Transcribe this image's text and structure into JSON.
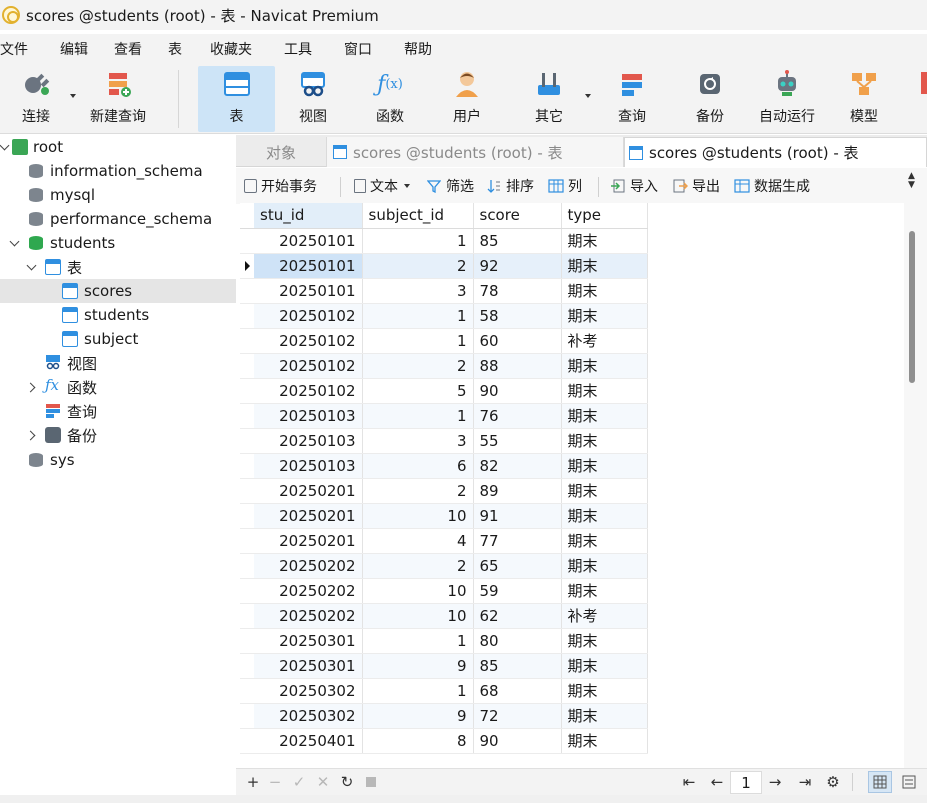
{
  "window": {
    "title": "scores @students (root) - 表 - Navicat Premium"
  },
  "menu": [
    "文件",
    "编辑",
    "查看",
    "表",
    "收藏夹",
    "工具",
    "窗口",
    "帮助"
  ],
  "toolbar": {
    "items": [
      {
        "label": "连接",
        "icon": "plug-icon"
      },
      {
        "label": "新建查询",
        "icon": "new-query-icon"
      },
      {
        "label": "表",
        "icon": "table-icon"
      },
      {
        "label": "视图",
        "icon": "view-icon"
      },
      {
        "label": "函数",
        "icon": "function-icon"
      },
      {
        "label": "用户",
        "icon": "user-icon"
      },
      {
        "label": "其它",
        "icon": "tools-icon"
      },
      {
        "label": "查询",
        "icon": "query-icon"
      },
      {
        "label": "备份",
        "icon": "backup-icon"
      },
      {
        "label": "自动运行",
        "icon": "robot-icon"
      },
      {
        "label": "模型",
        "icon": "model-icon"
      }
    ]
  },
  "tree": {
    "root": "root",
    "databases": [
      "information_schema",
      "mysql",
      "performance_schema",
      "students"
    ],
    "students_children": {
      "tables_label": "表",
      "tables": [
        "scores",
        "students",
        "subject"
      ],
      "views": "视图",
      "functions": "函数",
      "queries": "查询",
      "backups": "备份"
    },
    "sys": "sys"
  },
  "tabs": {
    "objects": "对象",
    "tab1": "scores @students (root) - 表",
    "tab2": "scores @students (root) - 表"
  },
  "objbar": {
    "begin_tx": "开始事务",
    "text": "文本",
    "filter": "筛选",
    "sort": "排序",
    "columns": "列",
    "import": "导入",
    "export": "导出",
    "datagen": "数据生成"
  },
  "grid": {
    "columns": [
      "stu_id",
      "subject_id",
      "score",
      "type"
    ],
    "rows": [
      [
        "20250101",
        "1",
        "85",
        "期末"
      ],
      [
        "20250101",
        "2",
        "92",
        "期末"
      ],
      [
        "20250101",
        "3",
        "78",
        "期末"
      ],
      [
        "20250102",
        "1",
        "58",
        "期末"
      ],
      [
        "20250102",
        "1",
        "60",
        "补考"
      ],
      [
        "20250102",
        "2",
        "88",
        "期末"
      ],
      [
        "20250102",
        "5",
        "90",
        "期末"
      ],
      [
        "20250103",
        "1",
        "76",
        "期末"
      ],
      [
        "20250103",
        "3",
        "55",
        "期末"
      ],
      [
        "20250103",
        "6",
        "82",
        "期末"
      ],
      [
        "20250201",
        "2",
        "89",
        "期末"
      ],
      [
        "20250201",
        "10",
        "91",
        "期末"
      ],
      [
        "20250201",
        "4",
        "77",
        "期末"
      ],
      [
        "20250202",
        "2",
        "65",
        "期末"
      ],
      [
        "20250202",
        "10",
        "59",
        "期末"
      ],
      [
        "20250202",
        "10",
        "62",
        "补考"
      ],
      [
        "20250301",
        "1",
        "80",
        "期末"
      ],
      [
        "20250301",
        "9",
        "85",
        "期末"
      ],
      [
        "20250302",
        "1",
        "68",
        "期末"
      ],
      [
        "20250302",
        "9",
        "72",
        "期末"
      ],
      [
        "20250401",
        "8",
        "90",
        "期末"
      ]
    ],
    "selected_row": 1
  },
  "nav": {
    "page": "1"
  },
  "colors": {
    "accent": "#cde4f7",
    "selected": "#cfe3f7",
    "alt_row": "#f5f9fd"
  }
}
